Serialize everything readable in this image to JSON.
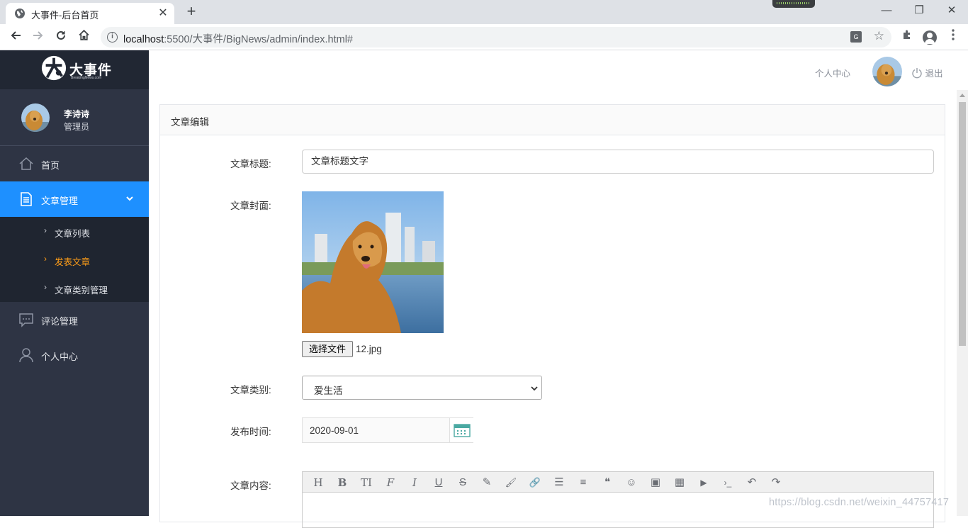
{
  "browser": {
    "tab_title": "大事件-后台首页",
    "tab_close": "✕",
    "new_tab": "+",
    "url_host": "localhost",
    "url_path": ":5500/大事件/BigNews/admin/index.html#",
    "win_minimize": "—",
    "win_restore": "❐",
    "win_close": "✕"
  },
  "sidebar": {
    "logo_text": "大事件",
    "logo_sub": "BreakingNews.com",
    "user_name": "李诗诗",
    "user_role": "管理员",
    "menu": [
      {
        "label": "首页",
        "icon": "home-icon"
      },
      {
        "label": "文章管理",
        "icon": "document-icon",
        "active": true
      },
      {
        "label": "评论管理",
        "icon": "comment-icon"
      },
      {
        "label": "个人中心",
        "icon": "user-icon"
      }
    ],
    "submenu": [
      {
        "label": "文章列表"
      },
      {
        "label": "发表文章",
        "current": true
      },
      {
        "label": "文章类别管理"
      }
    ]
  },
  "header": {
    "personal_center": "个人中心",
    "logout": "退出"
  },
  "panel": {
    "title": "文章编辑",
    "fields": {
      "title_label": "文章标题:",
      "title_value": "文章标题文字",
      "cover_label": "文章封面:",
      "file_button": "选择文件",
      "file_name": "12.jpg",
      "category_label": "文章类别:",
      "category_value": "爱生活",
      "date_label": "发布时间:",
      "date_value": "2020-09-01",
      "content_label": "文章内容:"
    },
    "editor_tools": [
      "H",
      "B",
      "TI",
      "F",
      "I",
      "U",
      "S",
      "✎",
      "🖌",
      "🔗",
      "☰",
      "≡",
      "❝",
      "☺",
      "▣",
      "▦",
      "▶",
      "›_",
      "↶",
      "↷"
    ]
  },
  "watermark": "https://blog.csdn.net/weixin_44757417",
  "colors": {
    "sidebar_bg": "#2e3444",
    "sidebar_active": "#1e90ff",
    "submenu_current": "#ff9e18"
  }
}
